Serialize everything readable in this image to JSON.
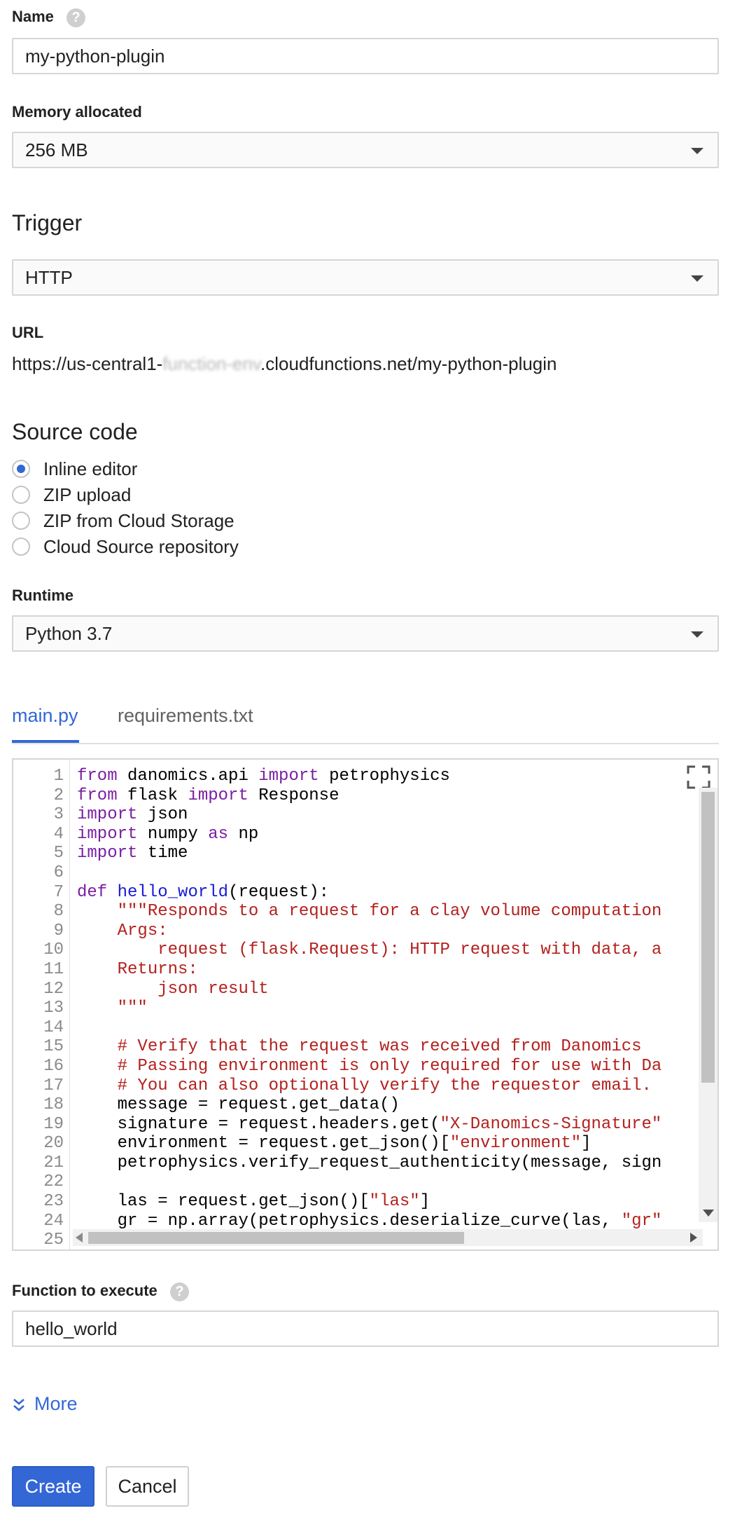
{
  "name_field": {
    "label": "Name",
    "help": "?",
    "value": "my-python-plugin"
  },
  "memory_field": {
    "label": "Memory allocated",
    "value": "256 MB"
  },
  "trigger": {
    "heading": "Trigger",
    "value": "HTTP"
  },
  "url": {
    "label": "URL",
    "prefix": "https://us-central1-",
    "redacted": "function-env",
    "suffix": ".cloudfunctions.net/my-python-plugin"
  },
  "source_code": {
    "heading": "Source code",
    "options": [
      "Inline editor",
      "ZIP upload",
      "ZIP from Cloud Storage",
      "Cloud Source repository"
    ],
    "selected": "Inline editor"
  },
  "runtime": {
    "label": "Runtime",
    "value": "Python 3.7"
  },
  "file_tabs": [
    "main.py",
    "requirements.txt"
  ],
  "code_lines": [
    {
      "n": "1",
      "text": "from danomics.api import petrophysics"
    },
    {
      "n": "2",
      "text": "from flask import Response"
    },
    {
      "n": "3",
      "text": "import json"
    },
    {
      "n": "4",
      "text": "import numpy as np"
    },
    {
      "n": "5",
      "text": "import time"
    },
    {
      "n": "6",
      "text": ""
    },
    {
      "n": "7",
      "text": "def hello_world(request):"
    },
    {
      "n": "8",
      "text": "    \"\"\"Responds to a request for a clay volume computation"
    },
    {
      "n": "9",
      "text": "    Args:"
    },
    {
      "n": "10",
      "text": "        request (flask.Request): HTTP request with data, a"
    },
    {
      "n": "11",
      "text": "    Returns:"
    },
    {
      "n": "12",
      "text": "        json result"
    },
    {
      "n": "13",
      "text": "    \"\"\""
    },
    {
      "n": "14",
      "text": ""
    },
    {
      "n": "15",
      "text": "    # Verify that the request was received from Danomics"
    },
    {
      "n": "16",
      "text": "    # Passing environment is only required for use with Da"
    },
    {
      "n": "17",
      "text": "    # You can also optionally verify the requestor email."
    },
    {
      "n": "18",
      "text": "    message = request.get_data()"
    },
    {
      "n": "19",
      "text": "    signature = request.headers.get(\"X-Danomics-Signature\""
    },
    {
      "n": "20",
      "text": "    environment = request.get_json()[\"environment\"]"
    },
    {
      "n": "21",
      "text": "    petrophysics.verify_request_authenticity(message, sign"
    },
    {
      "n": "22",
      "text": ""
    },
    {
      "n": "23",
      "text": "    las = request.get_json()[\"las\"]"
    },
    {
      "n": "24",
      "text": "    gr = np.array(petrophysics.deserialize_curve(las, \"gr\""
    },
    {
      "n": "25",
      "text": ""
    }
  ],
  "function_field": {
    "label": "Function to execute",
    "help": "?",
    "value": "hello_world"
  },
  "more_link": {
    "icon": "double-chevron-down-icon",
    "label": "More"
  },
  "actions": {
    "create": "Create",
    "cancel": "Cancel"
  },
  "colors": {
    "accent": "#3367d6",
    "keyword": "#7a1fa2",
    "function": "#1a1ad6",
    "string": "#b3211e"
  }
}
